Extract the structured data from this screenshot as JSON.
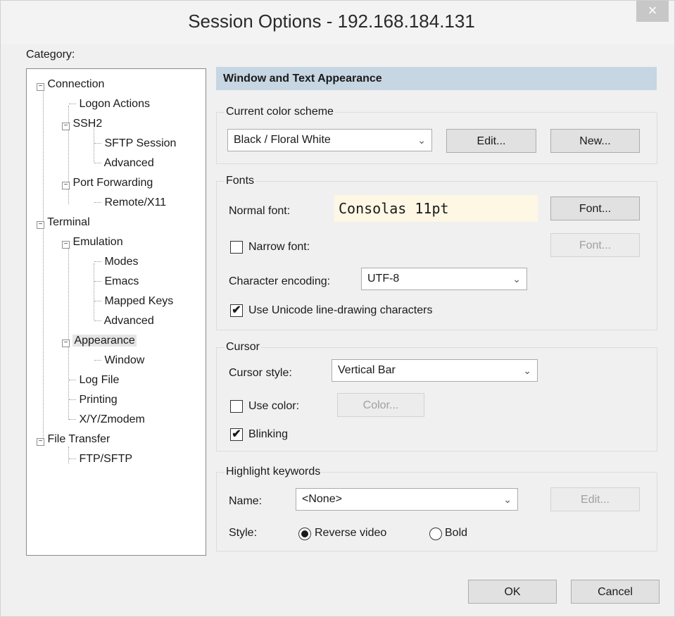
{
  "window": {
    "title": "Session Options - 192.168.184.131",
    "close_glyph": "×"
  },
  "category": {
    "label": "Category:",
    "tree": [
      {
        "label": "Connection",
        "depth": 0,
        "expander": "⊟"
      },
      {
        "label": "Logon Actions",
        "depth": 1
      },
      {
        "label": "SSH2",
        "depth": 1,
        "expander": "⊟"
      },
      {
        "label": "SFTP Session",
        "depth": 2
      },
      {
        "label": "Advanced",
        "depth": 2
      },
      {
        "label": "Port Forwarding",
        "depth": 1,
        "expander": "⊟"
      },
      {
        "label": "Remote/X11",
        "depth": 2
      },
      {
        "label": "Terminal",
        "depth": 0,
        "expander": "⊟"
      },
      {
        "label": "Emulation",
        "depth": 1,
        "expander": "⊟"
      },
      {
        "label": "Modes",
        "depth": 2
      },
      {
        "label": "Emacs",
        "depth": 2
      },
      {
        "label": "Mapped Keys",
        "depth": 2
      },
      {
        "label": "Advanced",
        "depth": 2
      },
      {
        "label": "Appearance",
        "depth": 1,
        "expander": "⊟",
        "selected": true
      },
      {
        "label": "Window",
        "depth": 2
      },
      {
        "label": "Log File",
        "depth": 1
      },
      {
        "label": "Printing",
        "depth": 1
      },
      {
        "label": "X/Y/Zmodem",
        "depth": 1
      },
      {
        "label": "File Transfer",
        "depth": 0,
        "expander": "⊟"
      },
      {
        "label": "FTP/SFTP",
        "depth": 1
      }
    ]
  },
  "panel": {
    "header": "Window and Text Appearance",
    "color_scheme": {
      "group_label": "Current color scheme",
      "value": "Black / Floral White",
      "edit_label": "Edit...",
      "new_label": "New..."
    },
    "fonts": {
      "group_label": "Fonts",
      "normal_font_label": "Normal font:",
      "normal_font_value": "Consolas 11pt",
      "font_button": "Font...",
      "narrow_font_label": "Narrow font:",
      "narrow_font_checked": false,
      "narrow_font_button": "Font...",
      "encoding_label": "Character encoding:",
      "encoding_value": "UTF-8",
      "unicode_label": "Use Unicode line-drawing characters",
      "unicode_checked": true
    },
    "cursor": {
      "group_label": "Cursor",
      "style_label": "Cursor style:",
      "style_value": "Vertical Bar",
      "use_color_label": "Use color:",
      "use_color_checked": false,
      "color_button": "Color...",
      "blinking_label": "Blinking",
      "blinking_checked": true
    },
    "highlight": {
      "group_label": "Highlight keywords",
      "name_label": "Name:",
      "name_value": "<None>",
      "edit_label": "Edit...",
      "style_label": "Style:",
      "reverse_label": "Reverse video",
      "bold_label": "Bold",
      "selected_style": "Reverse video"
    }
  },
  "footer": {
    "ok_label": "OK",
    "cancel_label": "Cancel"
  },
  "glyphs": {
    "check": "✔",
    "chevron": "⌄",
    "expander_minus": "−"
  },
  "colors": {
    "header_bg": "#c6d6e3",
    "font_preview_bg": "#fdf7e4"
  }
}
